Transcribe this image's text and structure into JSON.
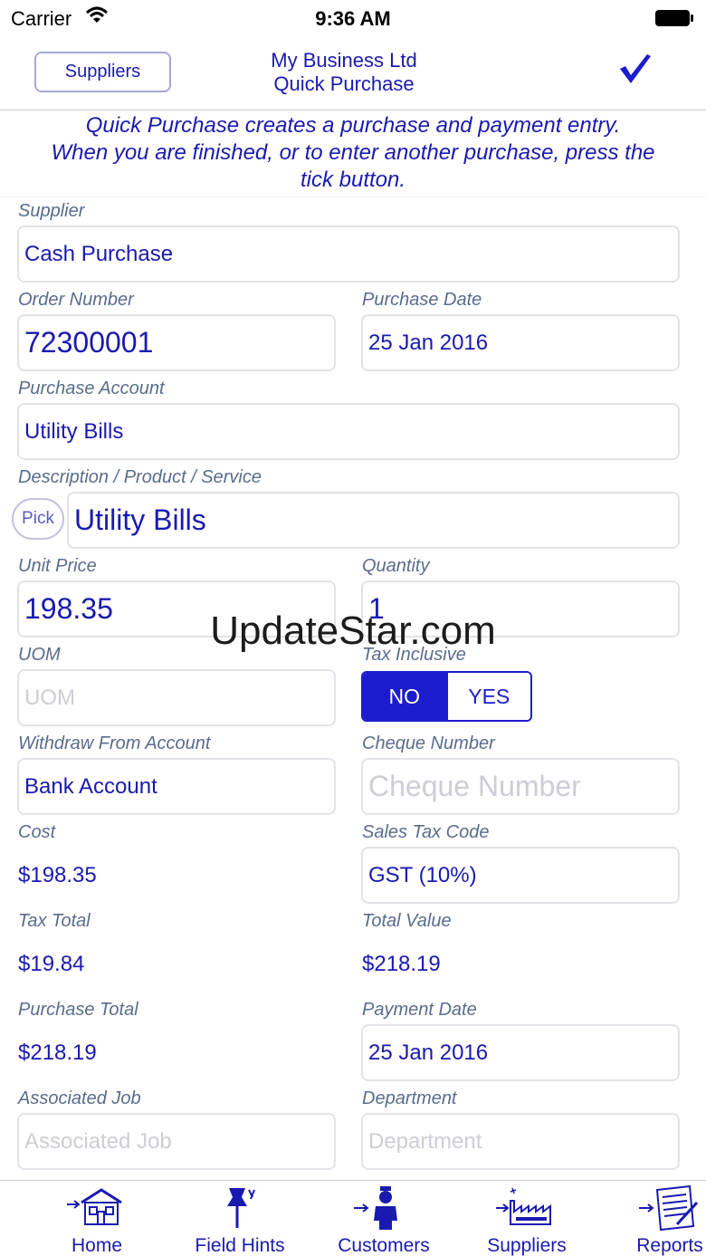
{
  "status": {
    "carrier": "Carrier",
    "time": "9:36 AM"
  },
  "nav": {
    "back_label": "Suppliers",
    "company": "My Business Ltd",
    "title": "Quick Purchase"
  },
  "banner": {
    "line1": "Quick Purchase creates a purchase and payment entry.",
    "line2": "When you are finished, or to enter another purchase, press the",
    "line3": "tick button."
  },
  "form": {
    "supplier": {
      "label": "Supplier",
      "value": "Cash Purchase"
    },
    "order_number": {
      "label": "Order Number",
      "value": "72300001"
    },
    "purchase_date": {
      "label": "Purchase Date",
      "value": "25 Jan 2016"
    },
    "purchase_account": {
      "label": "Purchase Account",
      "value": "Utility Bills"
    },
    "description": {
      "label": "Description / Product / Service",
      "value": "Utility Bills",
      "pick_label": "Pick"
    },
    "unit_price": {
      "label": "Unit Price",
      "value": "198.35"
    },
    "quantity": {
      "label": "Quantity",
      "value": "1"
    },
    "uom": {
      "label": "UOM",
      "placeholder": "UOM"
    },
    "tax_inclusive": {
      "label": "Tax Inclusive",
      "options": [
        "NO",
        "YES"
      ],
      "selected": "NO"
    },
    "withdraw_account": {
      "label": "Withdraw From Account",
      "value": "Bank Account"
    },
    "cheque_number": {
      "label": "Cheque Number",
      "placeholder": "Cheque Number"
    },
    "cost": {
      "label": "Cost",
      "value": "$198.35"
    },
    "sales_tax_code": {
      "label": "Sales Tax Code",
      "value": "GST (10%)"
    },
    "tax_total": {
      "label": "Tax Total",
      "value": "$19.84"
    },
    "total_value": {
      "label": "Total Value",
      "value": "$218.19"
    },
    "purchase_total": {
      "label": "Purchase Total",
      "value": "$218.19"
    },
    "payment_date": {
      "label": "Payment Date",
      "value": "25 Jan 2016"
    },
    "associated_job": {
      "label": "Associated Job",
      "placeholder": "Associated Job"
    },
    "department": {
      "label": "Department",
      "placeholder": "Department"
    }
  },
  "watermark": "UpdateStar.com",
  "tabs": [
    {
      "label": "Home",
      "icon": "home-icon"
    },
    {
      "label": "Field Hints",
      "icon": "pushpin-icon"
    },
    {
      "label": "Customers",
      "icon": "customer-figure-icon"
    },
    {
      "label": "Suppliers",
      "icon": "factory-icon"
    },
    {
      "label": "Reports",
      "icon": "report-icon"
    }
  ],
  "colors": {
    "accent": "#1a1ab0",
    "label": "#5a6c8c",
    "segment": "#1c1ccf",
    "placeholder": "#cdcdd6"
  }
}
